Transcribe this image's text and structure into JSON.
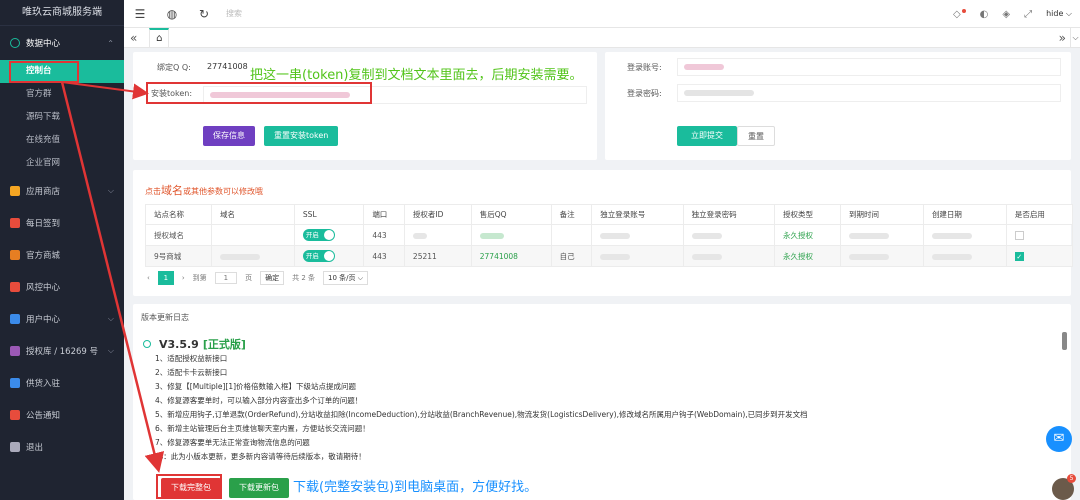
{
  "sidebar": {
    "brand": "唯玖云商城服务端",
    "data_center": "数据中心",
    "sub_items": [
      "控制台",
      "官方群",
      "源码下载",
      "在线充值",
      "企业官网"
    ],
    "items": [
      {
        "label": "应用商店",
        "icon": "app-store-icon",
        "chevron": true
      },
      {
        "label": "每日签到",
        "icon": "calendar-icon",
        "chevron": false
      },
      {
        "label": "官方商城",
        "icon": "cart-icon",
        "chevron": false
      },
      {
        "label": "风控中心",
        "icon": "shield-icon",
        "chevron": false
      },
      {
        "label": "用户中心",
        "icon": "user-icon",
        "chevron": true
      },
      {
        "label": "授权库 / 16269 号",
        "icon": "license-icon",
        "chevron": true
      },
      {
        "label": "供货入驻",
        "icon": "supply-icon",
        "chevron": false
      },
      {
        "label": "公告通知",
        "icon": "bell-icon",
        "chevron": false
      },
      {
        "label": "退出",
        "icon": "logout-icon",
        "chevron": false
      }
    ]
  },
  "topbar": {
    "search_placeholder": "搜索",
    "user": "hide"
  },
  "form_left": {
    "qq_label": "绑定Q Q:",
    "qq_value": "27741008",
    "token_label": "安装token:",
    "save_button": "保存信息",
    "reset_token_button": "重置安装token"
  },
  "form_right": {
    "account_label": "登录账号:",
    "password_label": "登录密码:",
    "submit_button": "立即提交",
    "reset_button": "重置"
  },
  "annotations": {
    "token_note": "把这一串(token)复制到文档文本里面去，后期安装需要。",
    "download_note": "下载(完整安装包)到电脑桌面，方便好找。"
  },
  "domain_hint": {
    "prefix": "点击",
    "strong": "域名",
    "suffix": "或其他参数可以修改哦"
  },
  "table": {
    "headers": [
      "站点名称",
      "域名",
      "SSL",
      "端口",
      "授权者ID",
      "售后QQ",
      "备注",
      "独立登录账号",
      "独立登录密码",
      "授权类型",
      "到期时间",
      "创建日期",
      "是否启用"
    ],
    "rows": [
      {
        "name": "授权域名",
        "ssl": "开启",
        "port": "443",
        "uid": "",
        "qq": "",
        "note": "",
        "type": "永久授权",
        "enabled": false
      },
      {
        "name": "9号商城",
        "ssl": "开启",
        "port": "443",
        "uid": "25211",
        "qq": "27741008",
        "note": "自己",
        "type": "永久授权",
        "enabled": true
      }
    ]
  },
  "pager": {
    "current": "1",
    "goto_label": "到第",
    "page_value": "1",
    "page_label": "页",
    "confirm": "确定",
    "total": "共 2 条",
    "per_page": "10 条/页"
  },
  "changelog": {
    "title": "版本更新日志",
    "version": "V3.5.9",
    "tag": "[正式版]",
    "items": [
      "1、适配授权益新接口",
      "2、适配卡卡云新接口",
      "3、修复【[Multiple][1]价格倍数输入框】下级站点提成问题",
      "4、修复源客要单时，可以输入部分内容查出多个订单的问题！",
      "5、新增应用钩子,订单退款(OrderRefund),分站收益扣除(IncomeDeduction),分站收益(BranchRevenue),物流发货(LogisticsDelivery),修改域名所属用户钩子(WebDomain),已同步到开发文档",
      "6、新增主站管理后台主页维信聊天室内置，方便站长交流问题！",
      "7、修复源客要单无法正常查询物流信息的问题",
      "Ps：此为小版本更新，更多新内容请等待后续版本，敬请期待！"
    ],
    "download_full": "下载完整包",
    "download_update": "下载更新包"
  },
  "colors": {
    "accent": "#1abc9c",
    "annot_green": "#52c41a",
    "annot_blue": "#1890ff",
    "highlight": "#e03535",
    "purple_btn": "#6f3fc1"
  }
}
